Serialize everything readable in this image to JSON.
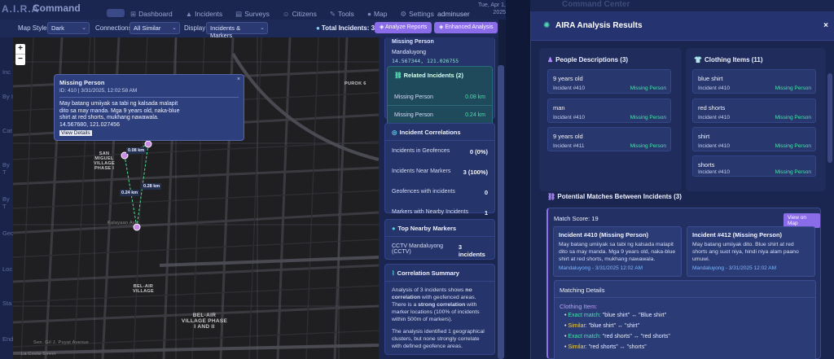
{
  "nav": {
    "logo": "A.I.R.A",
    "brand": "Command",
    "items": [
      {
        "icon": "dashboard-icon",
        "label": "Dashboard"
      },
      {
        "icon": "incidents-icon",
        "label": "Incidents"
      },
      {
        "icon": "surveys-icon",
        "label": "Surveys"
      },
      {
        "icon": "citizens-icon",
        "label": "Citizens"
      },
      {
        "icon": "tools-icon",
        "label": "Tools"
      },
      {
        "icon": "map-icon",
        "label": "Map"
      },
      {
        "icon": "settings-icon",
        "label": "Settings"
      }
    ],
    "user": "adminuser",
    "date_line1": "Tue, Apr 1,",
    "date_line2": "2025"
  },
  "toolbar": {
    "map_style_label": "Map Style:",
    "map_style_value": "Dark",
    "connections_label": "Connections:",
    "connections_value": "All Similar",
    "display_label": "Display:",
    "display_value": "Incidents & Markers",
    "total_incidents": "Total Incidents: 3",
    "analyze_button": "Analyze Reports",
    "enhanced_button": "Enhanced Analysis"
  },
  "left_labels": [
    "Inc",
    "By I",
    "Cat",
    "By T",
    "By T",
    "Geo",
    "Loc",
    "Sta",
    "End"
  ],
  "map": {
    "zoom_in": "+",
    "zoom_out": "−",
    "popup": {
      "title": "Missing Person",
      "meta": "ID: 410 | 3/31/2025, 12:02:58 AM",
      "description": "May batang umiiyak sa tabi ng kalsada malapit dito sa may manda. Mga 9 years old, naka-blue shirt at red shorts, mukhang nawawala.",
      "coords": "14.567680, 121.027456",
      "view_details": "View Details",
      "close": "×"
    },
    "labels": {
      "purok": "PUROK 6",
      "san_miguel": "SAN MIGUEL VILLAGE PHASE I",
      "bel_air": "BEL-AIR VILLAGE PHASE I AND II",
      "bel_air_small": "BEL-AIR VILLAGE",
      "street1": "Kalayaan Ave",
      "street2": "Sen. Gil J. Puyat Avenue",
      "street3": "La Costa Street"
    },
    "distances": [
      "0.08 km",
      "0.24 km",
      "0.28 km"
    ]
  },
  "sidebar": {
    "missing_person_header": "Missing Person",
    "location": "Mandaluyong",
    "coords": "14.567344, 121.026755",
    "related_title": "Related Incidents (2)",
    "related": [
      {
        "label": "Missing Person",
        "dist": "0.08 km"
      },
      {
        "label": "Missing Person",
        "dist": "0.24 km"
      }
    ],
    "correlations_title": "Incident Correlations",
    "correlations": [
      {
        "label": "Incidents in Geofences",
        "value": "0 (0%)"
      },
      {
        "label": "Incidents Near Markers",
        "value": "3 (100%)"
      },
      {
        "label": "Geofences with incidents",
        "value": "0"
      },
      {
        "label": "Markers with Nearby Incidents",
        "value": "1"
      }
    ],
    "top_markers_title": "Top Nearby Markers",
    "top_marker_label": "CCTV Mandaluyong (CCTV)",
    "top_marker_value": "3 incidents",
    "summary_title": "Correlation Summary",
    "summary_p1_a": "Analysis of 3 incidents shows ",
    "summary_p1_b": "no correlation",
    "summary_p1_c": " with geofenced areas. There is a ",
    "summary_p1_d": "strong correlation",
    "summary_p1_e": " with marker locations (100% of incidents within 500m of markers).",
    "summary_p2": "The analysis identified 1 geographical clusters, but none strongly correlate with defined geofence areas."
  },
  "modal": {
    "bg_text": "Command Center",
    "title": "AIRA Analysis Results",
    "close": "×",
    "people_title": "People Descriptions (3)",
    "people": [
      {
        "desc": "9 years old",
        "id": "Incident #410",
        "type": "Missing Person"
      },
      {
        "desc": "man",
        "id": "Incident #410",
        "type": "Missing Person"
      },
      {
        "desc": "9 years old",
        "id": "Incident #411",
        "type": "Missing Person"
      }
    ],
    "clothing_title": "Clothing Items (11)",
    "clothing": [
      {
        "desc": "blue shirt",
        "id": "Incident #410",
        "type": "Missing Person"
      },
      {
        "desc": "red shorts",
        "id": "Incident #410",
        "type": "Missing Person"
      },
      {
        "desc": "shirt",
        "id": "Incident #410",
        "type": "Missing Person"
      },
      {
        "desc": "shorts",
        "id": "Incident #410",
        "type": "Missing Person"
      }
    ],
    "matches_title": "Potential Matches Between Incidents (3)",
    "match_score": "Match Score: 19",
    "view_on_map": "View on Map",
    "match_a": {
      "title": "Incident #410 (Missing Person)",
      "desc": "May batang umiiyak sa tabi ng kalsada malapit dito sa may manda. Mga 9 years old, naka-blue shirt at red shorts, mukhang nawawala.",
      "meta": "Mandaluyong - 3/31/2025 12:02 AM"
    },
    "match_b": {
      "title": "Incident #412 (Missing Person)",
      "desc": "May batang umiiyak dito. Blue shirt at red shorts ang suot niya, hindi niya alam paano umuwi.",
      "meta": "Mandaluyong - 3/31/2025 12:02 AM"
    },
    "matching_details": "Matching Details",
    "clothing_item_label": "Clothing Item:",
    "bullets": [
      {
        "kind": "Exact match:",
        "text": " \"blue shirt\" ↔ \"Blue shirt\""
      },
      {
        "kind": "Similar:",
        "text": " \"blue shirt\" ↔ \"shirt\""
      },
      {
        "kind": "Exact match:",
        "text": " \"red shorts\" ↔ \"red shorts\""
      },
      {
        "kind": "Similar:",
        "text": " \"red shorts\" ↔ \"shorts\""
      }
    ]
  }
}
